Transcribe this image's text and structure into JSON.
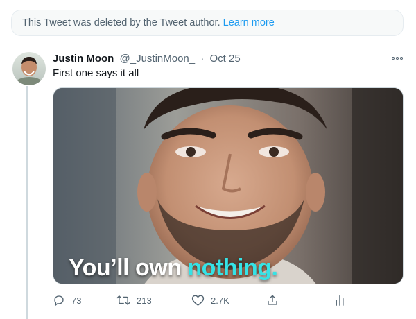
{
  "deleted_notice": {
    "text": "This Tweet was deleted by the Tweet author.",
    "link": "Learn more"
  },
  "tweet": {
    "name": "Justin Moon",
    "handle": "@_JustinMoon_",
    "separator": "·",
    "date": "Oct 25",
    "text": "First one says it all",
    "media_caption_part1": "You’ll own ",
    "media_caption_part2": "nothing.",
    "actions": {
      "reply_count": "73",
      "retweet_count": "213",
      "like_count": "2.7K"
    }
  },
  "colors": {
    "link": "#1d9bf0",
    "muted": "#536471",
    "caption_highlight": "#35e3e6"
  },
  "icons": [
    "more-icon",
    "reply-icon",
    "retweet-icon",
    "like-icon",
    "share-icon",
    "analytics-icon"
  ]
}
